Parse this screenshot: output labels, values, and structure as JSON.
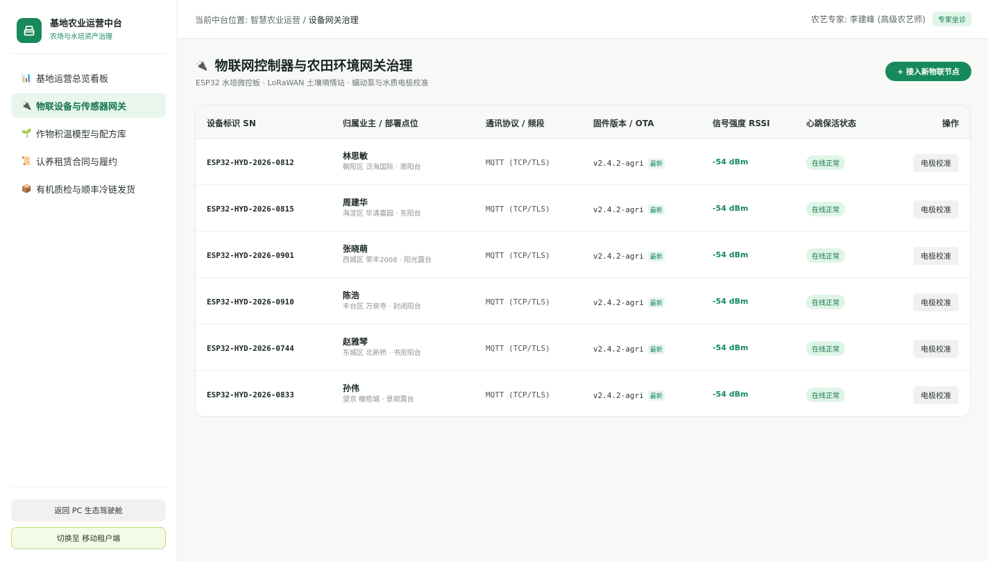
{
  "brand": {
    "title": "基地农业运营中台",
    "subtitle": "农场与水培资产治理",
    "icon": "box-icon"
  },
  "sidebar": {
    "items": [
      {
        "icon": "📊",
        "icon_name": "bar-chart-icon",
        "label": "基地运营总览看板",
        "active": false
      },
      {
        "icon": "🔌",
        "icon_name": "plug-icon",
        "label": "物联设备与传感器网关",
        "active": true
      },
      {
        "icon": "🌱",
        "icon_name": "seedling-icon",
        "label": "作物积温模型与配方库",
        "active": false
      },
      {
        "icon": "📜",
        "icon_name": "scroll-icon",
        "label": "认养租赁合同与履约",
        "active": false
      },
      {
        "icon": "📦",
        "icon_name": "package-icon",
        "label": "有机质检与顺丰冷链发货",
        "active": false
      }
    ],
    "back_pc": "返回 PC 生态驾驶舱",
    "switch_mobile": "切换至 移动租户端"
  },
  "header": {
    "breadcrumb_prefix": "当前中台位置:",
    "breadcrumb_parent": "智慧农业运营",
    "breadcrumb_sep": "/",
    "breadcrumb_current": "设备网关治理",
    "expert": "农艺专家: 李建峰 (高级农艺师)",
    "expert_badge": "专家坐诊"
  },
  "page": {
    "icon": "🔌",
    "title": "物联网控制器与农田环境网关治理",
    "subtitle": "ESP32 水培微控板 · LoRaWAN 土壤墒情站 · 蠕动泵与水质电极校准",
    "add_button": "+ 接入新物联节点"
  },
  "table": {
    "columns": [
      "设备标识 SN",
      "归属业主 / 部署点位",
      "通讯协议 / 频段",
      "固件版本 / OTA",
      "信号强度 RSSI",
      "心跳保活状态",
      "操作"
    ],
    "rows": [
      {
        "sn": "ESP32-HYD-2026-0812",
        "owner": "林思敏",
        "location": "朝阳区 泛海国际 · 南阳台",
        "protocol": "MQTT (TCP/TLS)",
        "firmware": "v2.4.2-agri",
        "fw_tag": "最新",
        "rssi": "-54 dBm",
        "status": "在线正常",
        "action": "电极校准"
      },
      {
        "sn": "ESP32-HYD-2026-0815",
        "owner": "周建华",
        "location": "海淀区 华清嘉园 · 东阳台",
        "protocol": "MQTT (TCP/TLS)",
        "firmware": "v2.4.2-agri",
        "fw_tag": "最新",
        "rssi": "-54 dBm",
        "status": "在线正常",
        "action": "电极校准"
      },
      {
        "sn": "ESP32-HYD-2026-0901",
        "owner": "张晓萌",
        "location": "西城区 荣丰2008 · 阳光露台",
        "protocol": "MQTT (TCP/TLS)",
        "firmware": "v2.4.2-agri",
        "fw_tag": "最新",
        "rssi": "-54 dBm",
        "status": "在线正常",
        "action": "电极校准"
      },
      {
        "sn": "ESP32-HYD-2026-0910",
        "owner": "陈浩",
        "location": "丰台区 万泉寺 · 封闭阳台",
        "protocol": "MQTT (TCP/TLS)",
        "firmware": "v2.4.2-agri",
        "fw_tag": "最新",
        "rssi": "-54 dBm",
        "status": "在线正常",
        "action": "电极校准"
      },
      {
        "sn": "ESP32-HYD-2026-0744",
        "owner": "赵雅琴",
        "location": "东城区 北新桥 · 书房阳台",
        "protocol": "MQTT (TCP/TLS)",
        "firmware": "v2.4.2-agri",
        "fw_tag": "最新",
        "rssi": "-54 dBm",
        "status": "在线正常",
        "action": "电极校准"
      },
      {
        "sn": "ESP32-HYD-2026-0833",
        "owner": "孙伟",
        "location": "望京 橄榄城 · 景观露台",
        "protocol": "MQTT (TCP/TLS)",
        "firmware": "v2.4.2-agri",
        "fw_tag": "最新",
        "rssi": "-54 dBm",
        "status": "在线正常",
        "action": "电极校准"
      }
    ]
  },
  "colors": {
    "accent": "#168a5a",
    "accent_light": "#e8f6ee",
    "badge_bg": "#dff5e7",
    "mobile_btn_border": "#b9e07a"
  }
}
